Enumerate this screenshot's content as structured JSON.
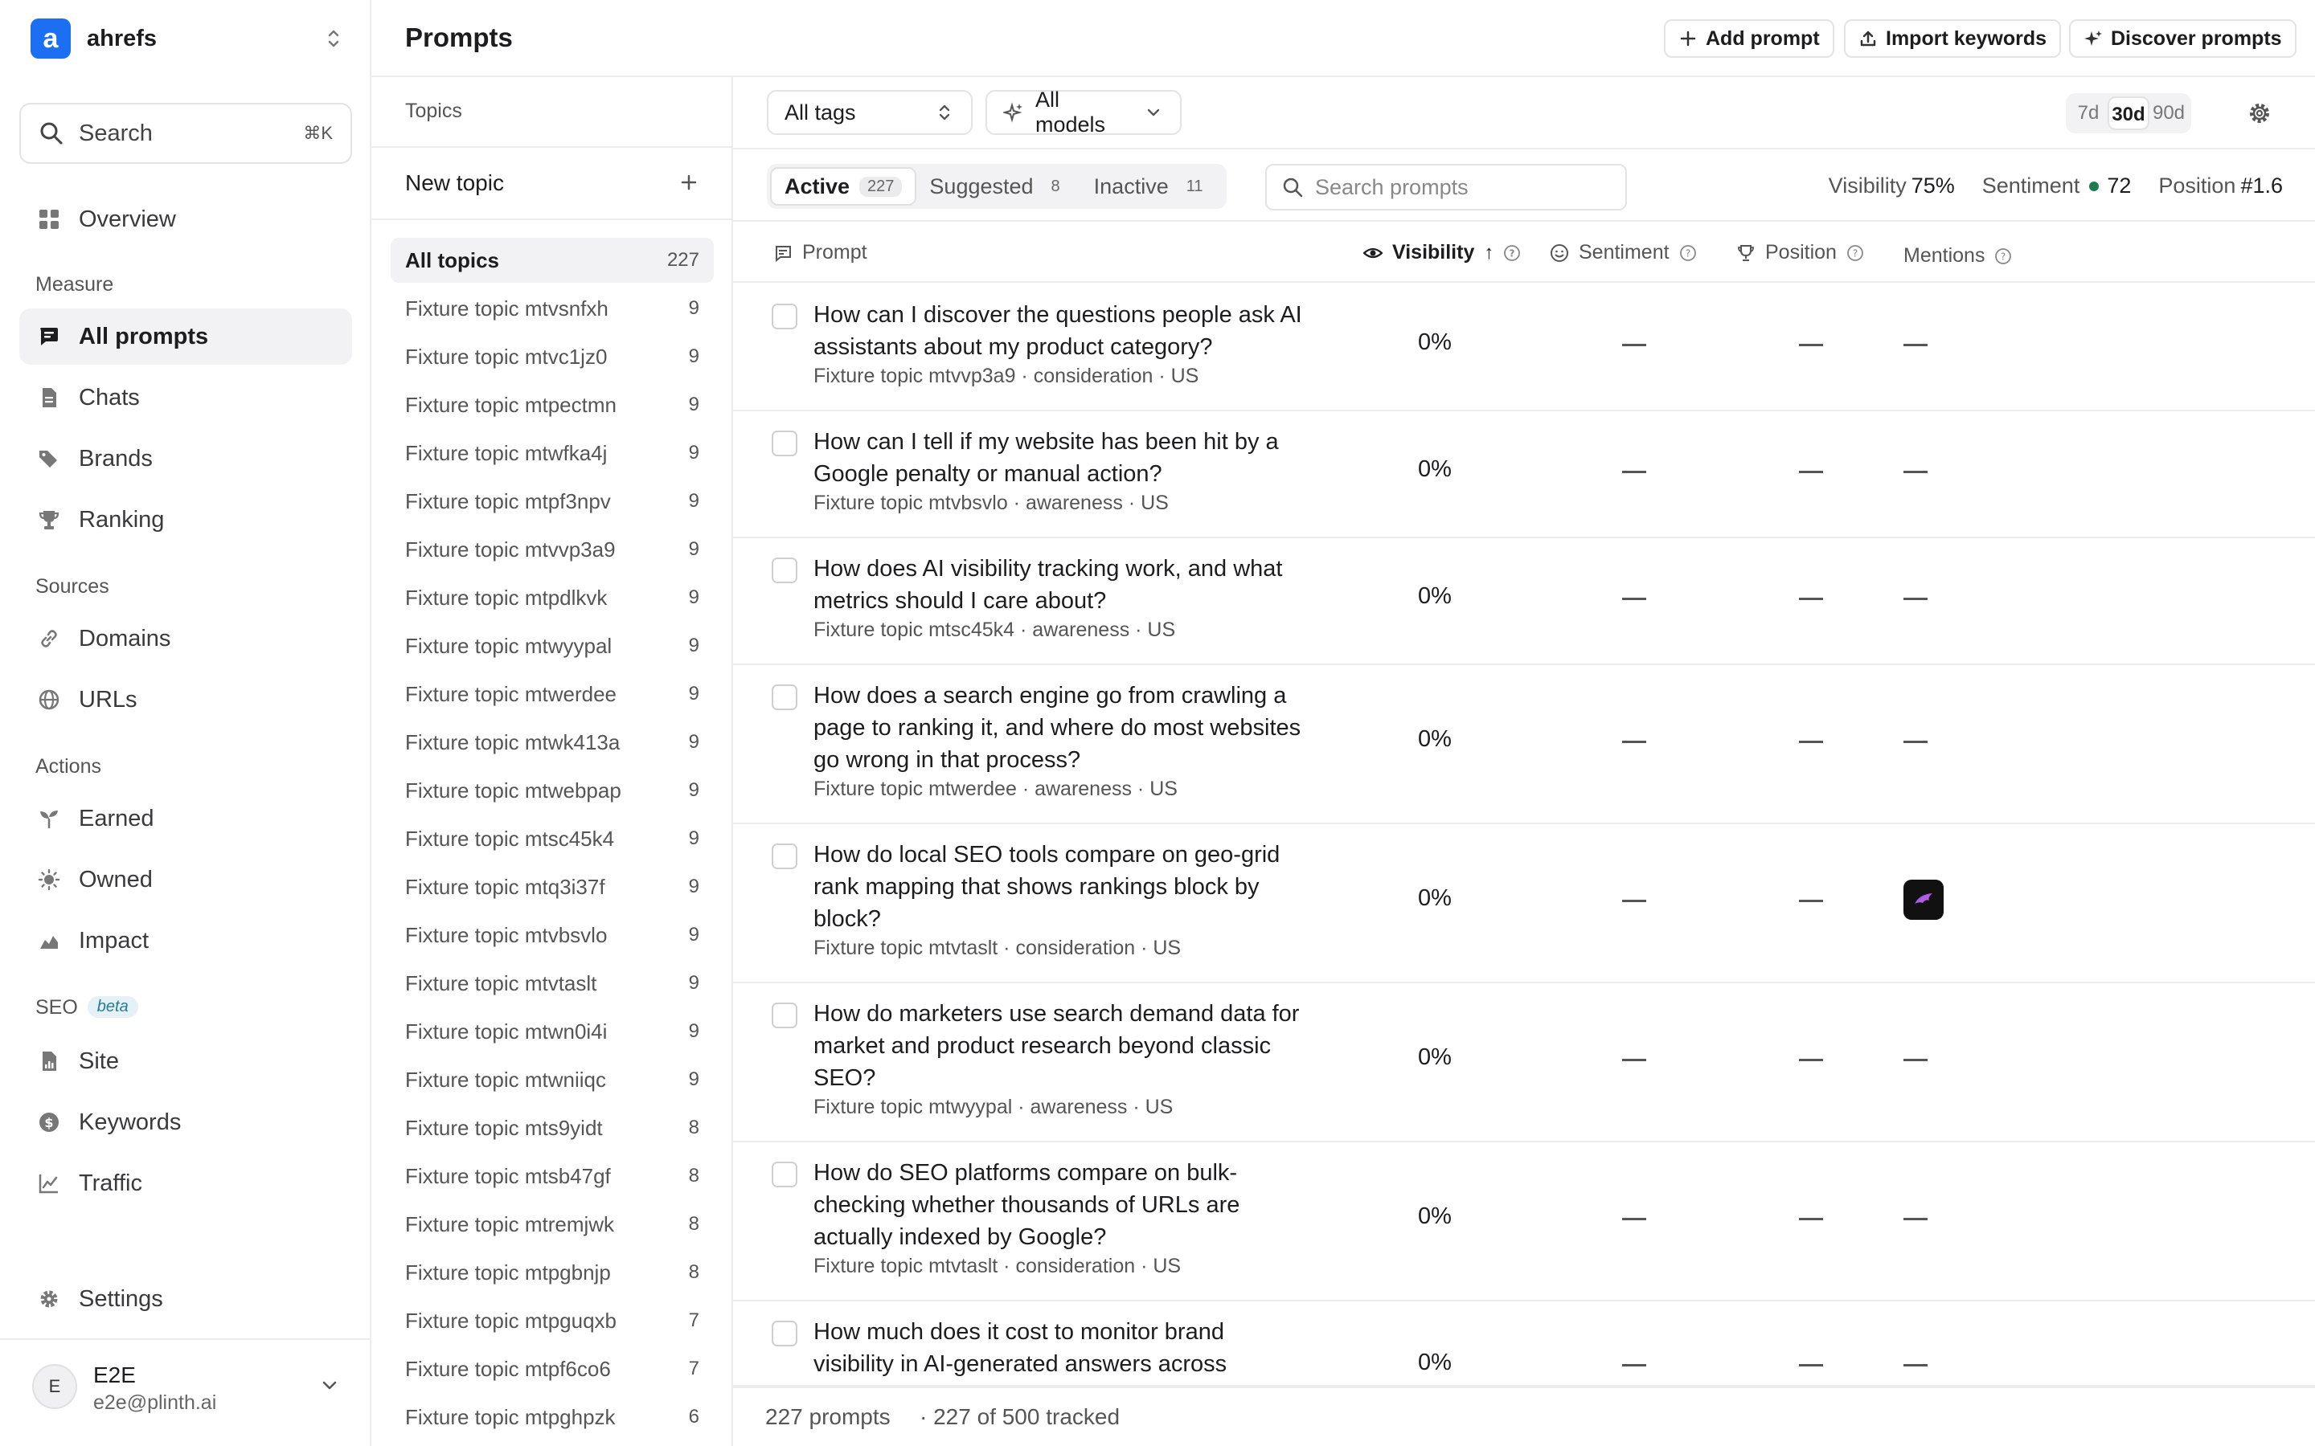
{
  "app": {
    "name": "ahrefs",
    "logo_letter": "a"
  },
  "sidebar": {
    "search": {
      "label": "Search",
      "shortcut": "⌘K"
    },
    "overview": "Overview",
    "sections": {
      "measure": "Measure",
      "sources": "Sources",
      "actions": "Actions",
      "seo": "SEO",
      "seo_badge": "beta"
    },
    "items": {
      "all_prompts": "All prompts",
      "chats": "Chats",
      "brands": "Brands",
      "ranking": "Ranking",
      "domains": "Domains",
      "urls": "URLs",
      "earned": "Earned",
      "owned": "Owned",
      "impact": "Impact",
      "site": "Site",
      "keywords": "Keywords",
      "traffic": "Traffic",
      "settings": "Settings"
    },
    "user": {
      "initial": "E",
      "name": "E2E",
      "email": "e2e@plinth.ai"
    }
  },
  "header": {
    "title": "Prompts",
    "add_prompt": "Add prompt",
    "import_keywords": "Import keywords",
    "discover_prompts": "Discover prompts"
  },
  "topics": {
    "heading": "Topics",
    "new_topic": "New topic",
    "list": [
      {
        "name": "All topics",
        "count": "227"
      },
      {
        "name": "Fixture topic mtvsnfxh",
        "count": "9"
      },
      {
        "name": "Fixture topic mtvc1jz0",
        "count": "9"
      },
      {
        "name": "Fixture topic mtpectmn",
        "count": "9"
      },
      {
        "name": "Fixture topic mtwfka4j",
        "count": "9"
      },
      {
        "name": "Fixture topic mtpf3npv",
        "count": "9"
      },
      {
        "name": "Fixture topic mtvvp3a9",
        "count": "9"
      },
      {
        "name": "Fixture topic mtpdlkvk",
        "count": "9"
      },
      {
        "name": "Fixture topic mtwyypal",
        "count": "9"
      },
      {
        "name": "Fixture topic mtwerdee",
        "count": "9"
      },
      {
        "name": "Fixture topic mtwk413a",
        "count": "9"
      },
      {
        "name": "Fixture topic mtwebpap",
        "count": "9"
      },
      {
        "name": "Fixture topic mtsc45k4",
        "count": "9"
      },
      {
        "name": "Fixture topic mtq3i37f",
        "count": "9"
      },
      {
        "name": "Fixture topic mtvbsvlo",
        "count": "9"
      },
      {
        "name": "Fixture topic mtvtaslt",
        "count": "9"
      },
      {
        "name": "Fixture topic mtwn0i4i",
        "count": "9"
      },
      {
        "name": "Fixture topic mtwniiqc",
        "count": "9"
      },
      {
        "name": "Fixture topic mts9yidt",
        "count": "8"
      },
      {
        "name": "Fixture topic mtsb47gf",
        "count": "8"
      },
      {
        "name": "Fixture topic mtremjwk",
        "count": "8"
      },
      {
        "name": "Fixture topic mtpgbnjp",
        "count": "8"
      },
      {
        "name": "Fixture topic mtpguqxb",
        "count": "7"
      },
      {
        "name": "Fixture topic mtpf6co6",
        "count": "7"
      },
      {
        "name": "Fixture topic mtpghpzk",
        "count": "6"
      }
    ]
  },
  "toolbar": {
    "tags_select": "All tags",
    "models_select": "All models",
    "ranges": [
      "7d",
      "30d",
      "90d"
    ],
    "range_selected": "30d"
  },
  "tabs": [
    {
      "label": "Active",
      "count": "227"
    },
    {
      "label": "Suggested",
      "count": "8"
    },
    {
      "label": "Inactive",
      "count": "11"
    }
  ],
  "prompt_search": {
    "placeholder": "Search prompts"
  },
  "stats": {
    "visibility_label": "Visibility",
    "visibility_value": "75%",
    "sentiment_label": "Sentiment",
    "sentiment_value": "72",
    "position_label": "Position",
    "position_value": "#1.6"
  },
  "columns": {
    "prompt": "Prompt",
    "visibility": "Visibility",
    "sentiment": "Sentiment",
    "position": "Position",
    "mentions": "Mentions"
  },
  "rows": [
    {
      "q1": "How can I discover the questions people ask AI",
      "q2": "assistants about my product category?",
      "q3": "",
      "meta": "Fixture topic mtvvp3a9 · consideration · US",
      "visibility": "0%",
      "sentiment": "—",
      "position": "—",
      "mentions": "—"
    },
    {
      "q1": "How can I tell if my website has been hit by a",
      "q2": "Google penalty or manual action?",
      "q3": "",
      "meta": "Fixture topic mtvbsvlo · awareness · US",
      "visibility": "0%",
      "sentiment": "—",
      "position": "—",
      "mentions": "—"
    },
    {
      "q1": "How does AI visibility tracking work, and what",
      "q2": "metrics should I care about?",
      "q3": "",
      "meta": "Fixture topic mtsc45k4 · awareness · US",
      "visibility": "0%",
      "sentiment": "—",
      "position": "—",
      "mentions": "—"
    },
    {
      "q1": "How does a search engine go from crawling a",
      "q2": "page to ranking it, and where do most websites",
      "q3": "go wrong in that process?",
      "meta": "Fixture topic mtwerdee · awareness · US",
      "visibility": "0%",
      "sentiment": "—",
      "position": "—",
      "mentions": "—"
    },
    {
      "q1": "How do local SEO tools compare on geo-grid",
      "q2": "rank mapping that shows rankings block by",
      "q3": "block?",
      "meta": "Fixture topic mtvtaslt · consideration · US",
      "visibility": "0%",
      "sentiment": "—",
      "position": "—",
      "mentions": ""
    },
    {
      "q1": "How do marketers use search demand data for",
      "q2": "market and product research beyond classic",
      "q3": "SEO?",
      "meta": "Fixture topic mtwyypal · awareness · US",
      "visibility": "0%",
      "sentiment": "—",
      "position": "—",
      "mentions": "—"
    },
    {
      "q1": "How do SEO platforms compare on bulk-",
      "q2": "checking whether thousands of URLs are",
      "q3": "actually indexed by Google?",
      "meta": "Fixture topic mtvtaslt · consideration · US",
      "visibility": "0%",
      "sentiment": "—",
      "position": "—",
      "mentions": "—"
    },
    {
      "q1": "How much does it cost to monitor brand",
      "q2": "visibility in AI-generated answers across",
      "q3": "",
      "meta": "",
      "visibility": "0%",
      "sentiment": "—",
      "position": "—",
      "mentions": "—"
    }
  ],
  "footer": {
    "prompts_count": "227 prompts",
    "tracked": "· 227 of 500 tracked"
  },
  "colors": {
    "brand": "#1c6ef2",
    "sentiment_dot": "#1f7a52",
    "beta_bg": "#e4f1f7"
  }
}
